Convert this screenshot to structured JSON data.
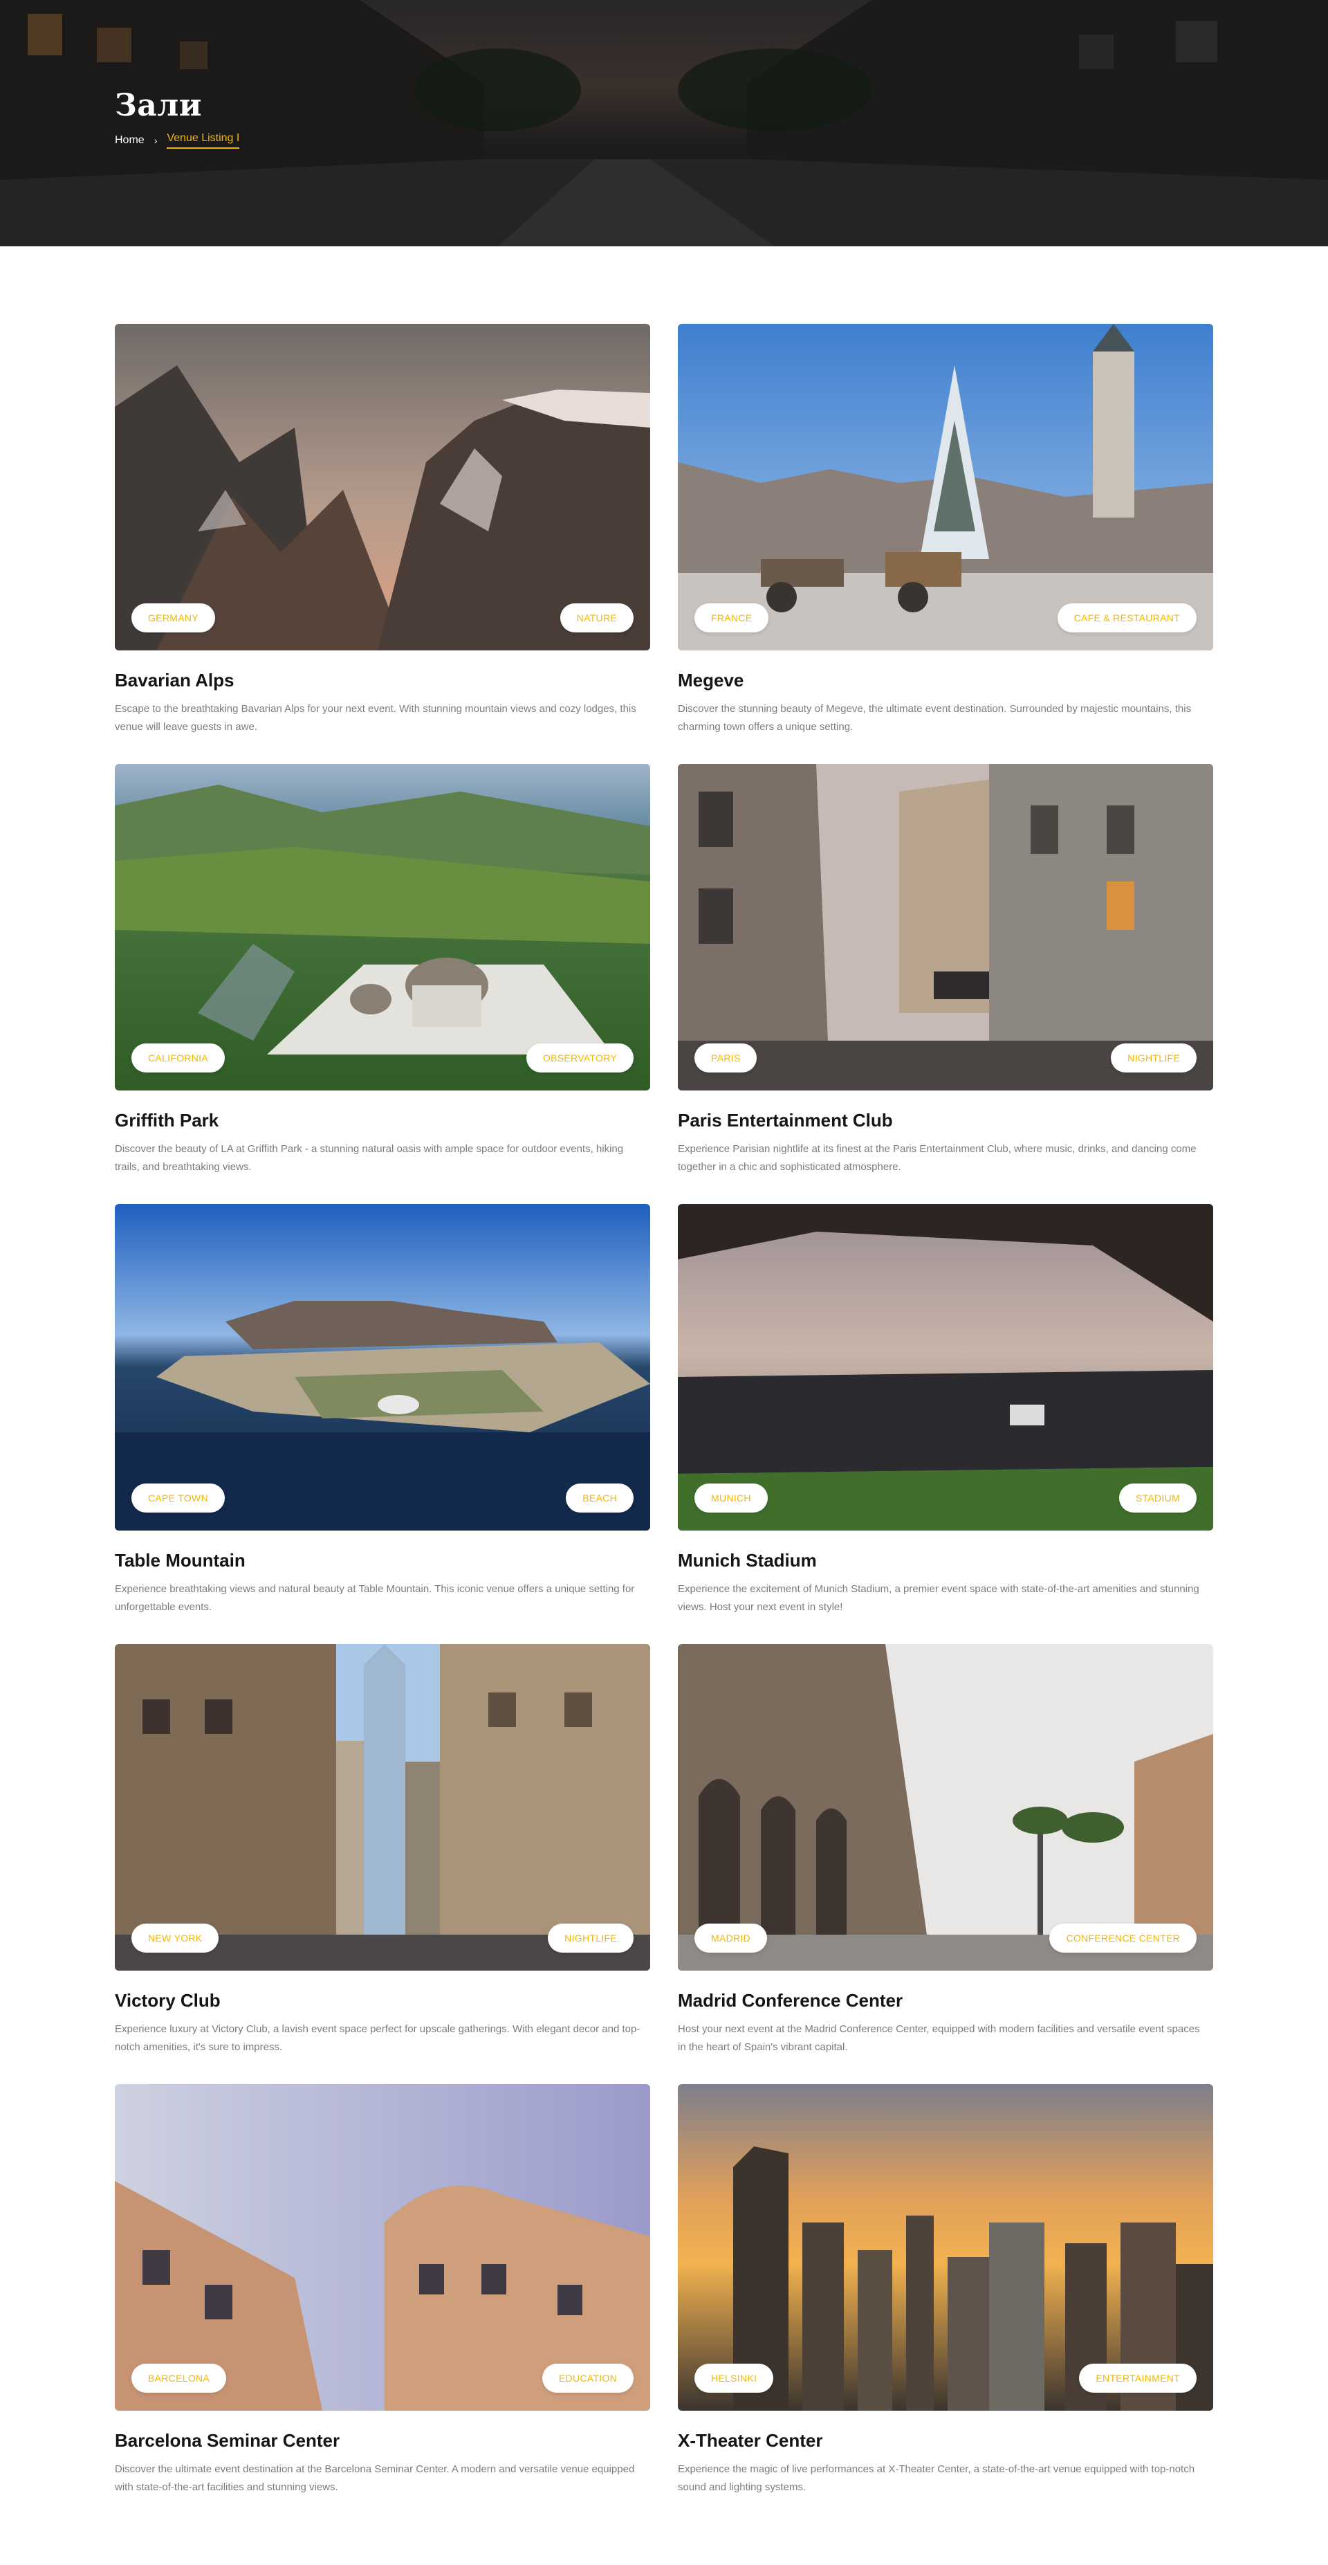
{
  "hero": {
    "title": "Зали",
    "breadcrumb_home": "Home",
    "breadcrumb_separator": "›",
    "breadcrumb_current": "Venue Listing I"
  },
  "colors": {
    "accent": "#f5b700",
    "title": "#151515",
    "text": "#7c7c7c"
  },
  "venues": [
    {
      "title": "Bavarian Alps",
      "tag_left": "GERMANY",
      "tag_right": "NATURE",
      "description": "Escape to the breathtaking Bavarian Alps for your next event. With stunning mountain views and cozy lodges, this venue will leave guests in awe."
    },
    {
      "title": "Megeve",
      "tag_left": "FRANCE",
      "tag_right": "CAFE & RESTAURANT",
      "description": "Discover the stunning beauty of Megeve, the ultimate event destination. Surrounded by majestic mountains, this charming town offers a unique setting."
    },
    {
      "title": "Griffith Park",
      "tag_left": "CALIFORNIA",
      "tag_right": "OBSERVATORY",
      "description": "Discover the beauty of LA at Griffith Park - a stunning natural oasis with ample space for outdoor events, hiking trails, and breathtaking views."
    },
    {
      "title": "Paris Entertainment Club",
      "tag_left": "PARIS",
      "tag_right": "NIGHTLIFE",
      "description": "Experience Parisian nightlife at its finest at the Paris Entertainment Club, where music, drinks, and dancing come together in a chic and sophisticated atmosphere."
    },
    {
      "title": "Table Mountain",
      "tag_left": "CAPE TOWN",
      "tag_right": "BEACH",
      "description": "Experience breathtaking views and natural beauty at Table Mountain. This iconic venue offers a unique setting for unforgettable events."
    },
    {
      "title": "Munich Stadium",
      "tag_left": "MUNICH",
      "tag_right": "STADIUM",
      "description": "Experience the excitement of Munich Stadium, a premier event space with state-of-the-art amenities and stunning views. Host your next event in style!"
    },
    {
      "title": "Victory Club",
      "tag_left": "NEW YORK",
      "tag_right": "NIGHTLIFE",
      "description": "Experience luxury at Victory Club, a lavish event space perfect for upscale gatherings. With elegant decor and top-notch amenities, it's sure to impress."
    },
    {
      "title": "Madrid Conference Center",
      "tag_left": "MADRID",
      "tag_right": "CONFERENCE CENTER",
      "description": "Host your next event at the Madrid Conference Center, equipped with modern facilities and versatile event spaces in the heart of Spain's vibrant capital."
    },
    {
      "title": "Barcelona Seminar Center",
      "tag_left": "BARCELONA",
      "tag_right": "EDUCATION",
      "description": "Discover the ultimate event destination at the Barcelona Seminar Center. A modern and versatile venue equipped with state-of-the-art facilities and stunning views."
    },
    {
      "title": "X-Theater Center",
      "tag_left": "HELSINKI",
      "tag_right": "ENTERTAINMENT",
      "description": "Experience the magic of live performances at X-Theater Center, a state-of-the-art venue equipped with top-notch sound and lighting systems."
    }
  ]
}
